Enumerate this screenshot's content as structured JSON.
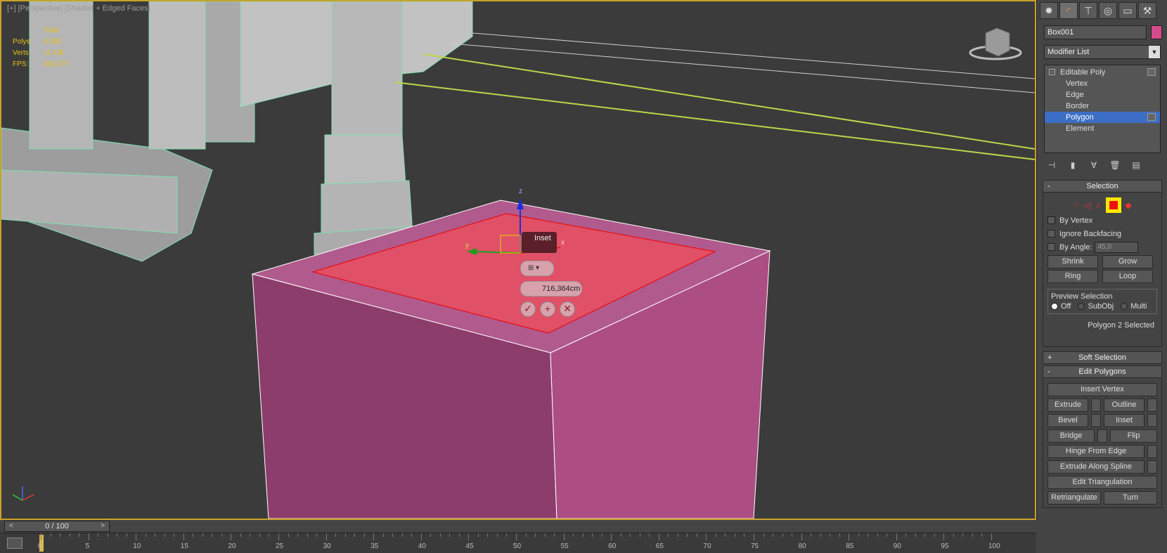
{
  "viewport": {
    "label": "[+] [Perspective] [Shaded + Edged Faces]",
    "stats": [
      {
        "k": "",
        "v": "Total"
      },
      {
        "k": "Polys:",
        "v": "6 993"
      },
      {
        "k": "Verts:",
        "v": "11 426"
      },
      {
        "k": "",
        "v": ""
      },
      {
        "k": "FPS:",
        "v": "309,277"
      }
    ],
    "caddy": {
      "title": "Inset",
      "value": "716,364cm",
      "ok": "✓",
      "apply": "+",
      "cancel": "✕"
    },
    "gizmo": {
      "x": "x",
      "y": "y",
      "z": "z"
    }
  },
  "panel": {
    "object_name": "Box001",
    "object_color": "#d64b8c",
    "modifier_list": "Modifier List",
    "stack": [
      {
        "label": "Editable Poly",
        "top": true
      },
      {
        "label": "Vertex"
      },
      {
        "label": "Edge"
      },
      {
        "label": "Border"
      },
      {
        "label": "Polygon",
        "selected": true
      },
      {
        "label": "Element"
      }
    ],
    "selection": {
      "title": "Selection",
      "by_vertex": "By Vertex",
      "ignore_backfacing": "Ignore Backfacing",
      "by_angle": "By Angle:",
      "angle_value": "45,0",
      "shrink": "Shrink",
      "grow": "Grow",
      "ring": "Ring",
      "loop": "Loop",
      "preview_title": "Preview Selection",
      "preview_off": "Off",
      "preview_subobj": "SubObj",
      "preview_multi": "Multi",
      "status": "Polygon 2 Selected"
    },
    "soft_selection": "Soft Selection",
    "edit_polygons": {
      "title": "Edit Polygons",
      "insert_vertex": "Insert Vertex",
      "extrude": "Extrude",
      "outline": "Outline",
      "bevel": "Bevel",
      "inset": "Inset",
      "bridge": "Bridge",
      "flip": "Flip",
      "hinge": "Hinge From Edge",
      "extrude_spline": "Extrude Along Spline",
      "edit_tri": "Edit Triangulation",
      "retriangulate": "Retriangulate",
      "turn": "Turn"
    }
  },
  "timeline": {
    "frame": "0 / 100",
    "ticks": [
      "0",
      "5",
      "10",
      "15",
      "20",
      "25",
      "30",
      "35",
      "40",
      "45",
      "50",
      "55",
      "60",
      "65",
      "70",
      "75",
      "80",
      "85",
      "90",
      "95",
      "100"
    ]
  }
}
